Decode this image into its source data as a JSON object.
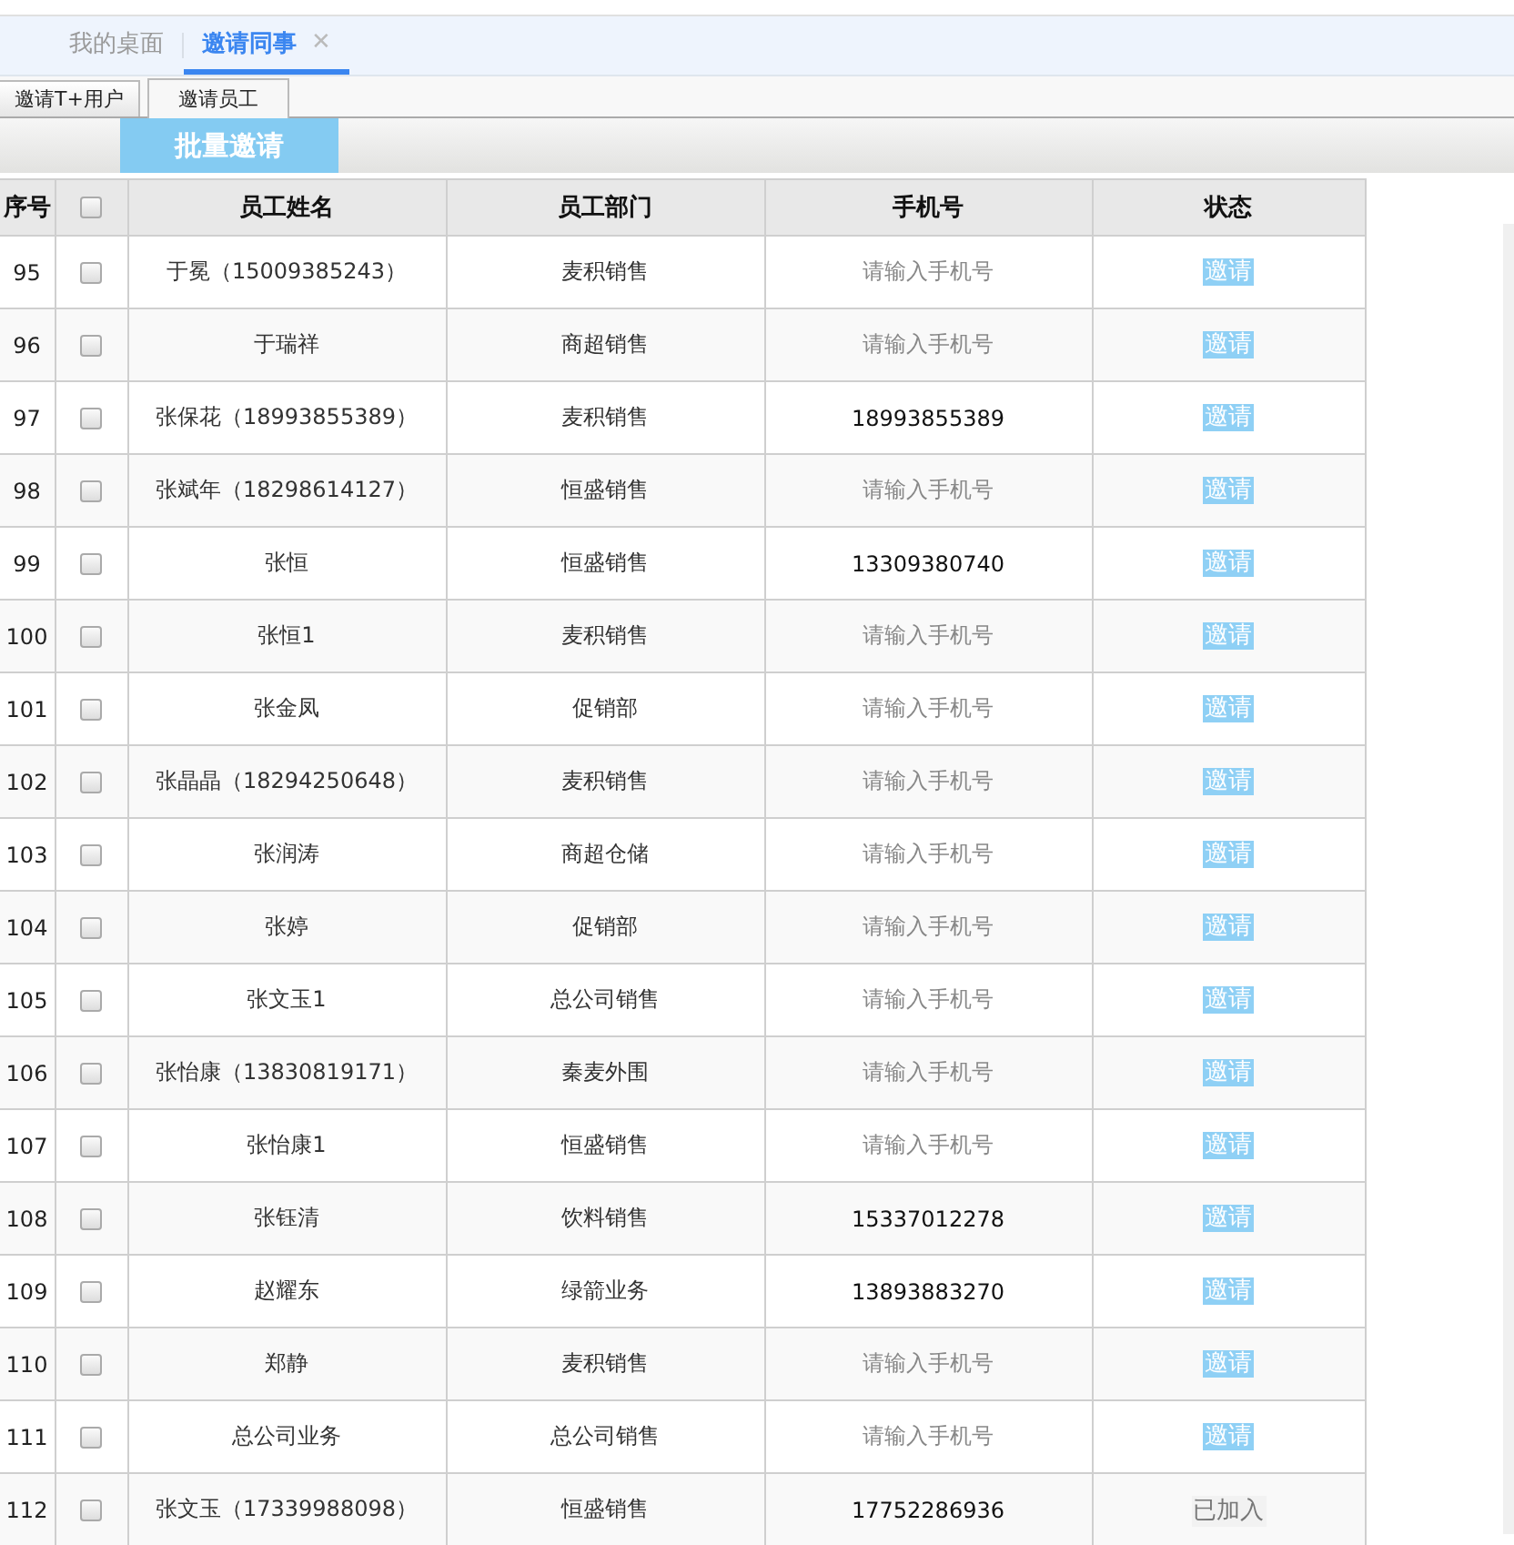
{
  "tabs": [
    {
      "label": "我的桌面",
      "selected": false
    },
    {
      "label": "邀请同事",
      "selected": true,
      "close_icon": "✕"
    }
  ],
  "sub_tabs": [
    {
      "label": "邀请T+用户",
      "selected": false
    },
    {
      "label": "邀请员工",
      "selected": true
    }
  ],
  "toolbar": {
    "batch_button": "批量邀请"
  },
  "table": {
    "columns": [
      "序号",
      "员工姓名",
      "员工部门",
      "手机号",
      "状态"
    ],
    "header_checkbox": {
      "checked": false
    },
    "rows": [
      {
        "no": "95",
        "checked": false,
        "name": "于冕（15009385243）",
        "dept": "麦积销售",
        "phone": {
          "placeholder": "请输入手机号"
        },
        "status": {
          "kind": "invite",
          "label": "邀请"
        }
      },
      {
        "no": "96",
        "checked": false,
        "name": "于瑞祥",
        "dept": "商超销售",
        "phone": {
          "placeholder": "请输入手机号"
        },
        "status": {
          "kind": "invite",
          "label": "邀请"
        }
      },
      {
        "no": "97",
        "checked": false,
        "name": "张保花（18993855389）",
        "dept": "麦积销售",
        "phone": {
          "value": "18993855389"
        },
        "status": {
          "kind": "invite",
          "label": "邀请"
        }
      },
      {
        "no": "98",
        "checked": false,
        "name": "张斌年（18298614127）",
        "dept": "恒盛销售",
        "phone": {
          "placeholder": "请输入手机号"
        },
        "status": {
          "kind": "invite",
          "label": "邀请"
        }
      },
      {
        "no": "99",
        "checked": false,
        "name": "张恒",
        "dept": "恒盛销售",
        "phone": {
          "value": "13309380740"
        },
        "status": {
          "kind": "invite",
          "label": "邀请"
        }
      },
      {
        "no": "100",
        "checked": false,
        "name": "张恒1",
        "dept": "麦积销售",
        "phone": {
          "placeholder": "请输入手机号"
        },
        "status": {
          "kind": "invite",
          "label": "邀请"
        }
      },
      {
        "no": "101",
        "checked": false,
        "name": "张金凤",
        "dept": "促销部",
        "phone": {
          "placeholder": "请输入手机号"
        },
        "status": {
          "kind": "invite",
          "label": "邀请"
        }
      },
      {
        "no": "102",
        "checked": false,
        "name": "张晶晶（18294250648）",
        "dept": "麦积销售",
        "phone": {
          "placeholder": "请输入手机号"
        },
        "status": {
          "kind": "invite",
          "label": "邀请"
        }
      },
      {
        "no": "103",
        "checked": false,
        "name": "张润涛",
        "dept": "商超仓储",
        "phone": {
          "placeholder": "请输入手机号"
        },
        "status": {
          "kind": "invite",
          "label": "邀请"
        }
      },
      {
        "no": "104",
        "checked": false,
        "name": "张婷",
        "dept": "促销部",
        "phone": {
          "placeholder": "请输入手机号"
        },
        "status": {
          "kind": "invite",
          "label": "邀请"
        }
      },
      {
        "no": "105",
        "checked": false,
        "name": "张文玉1",
        "dept": "总公司销售",
        "phone": {
          "placeholder": "请输入手机号"
        },
        "status": {
          "kind": "invite",
          "label": "邀请"
        }
      },
      {
        "no": "106",
        "checked": false,
        "name": "张怡康（13830819171）",
        "dept": "秦麦外围",
        "phone": {
          "placeholder": "请输入手机号"
        },
        "status": {
          "kind": "invite",
          "label": "邀请"
        }
      },
      {
        "no": "107",
        "checked": false,
        "name": "张怡康1",
        "dept": "恒盛销售",
        "phone": {
          "placeholder": "请输入手机号"
        },
        "status": {
          "kind": "invite",
          "label": "邀请"
        }
      },
      {
        "no": "108",
        "checked": false,
        "name": "张钰清",
        "dept": "饮料销售",
        "phone": {
          "value": "15337012278"
        },
        "status": {
          "kind": "invite",
          "label": "邀请"
        }
      },
      {
        "no": "109",
        "checked": false,
        "name": "赵耀东",
        "dept": "绿箭业务",
        "phone": {
          "value": "13893883270"
        },
        "status": {
          "kind": "invite",
          "label": "邀请"
        }
      },
      {
        "no": "110",
        "checked": false,
        "name": "郑静",
        "dept": "麦积销售",
        "phone": {
          "placeholder": "请输入手机号"
        },
        "status": {
          "kind": "invite",
          "label": "邀请"
        }
      },
      {
        "no": "111",
        "checked": false,
        "name": "总公司业务",
        "dept": "总公司销售",
        "phone": {
          "placeholder": "请输入手机号"
        },
        "status": {
          "kind": "invite",
          "label": "邀请"
        }
      },
      {
        "no": "112",
        "checked": false,
        "name": "张文玉（17339988098）",
        "dept": "恒盛销售",
        "phone": {
          "value": "17752286936"
        },
        "status": {
          "kind": "joined",
          "label": "已加入"
        }
      }
    ]
  }
}
